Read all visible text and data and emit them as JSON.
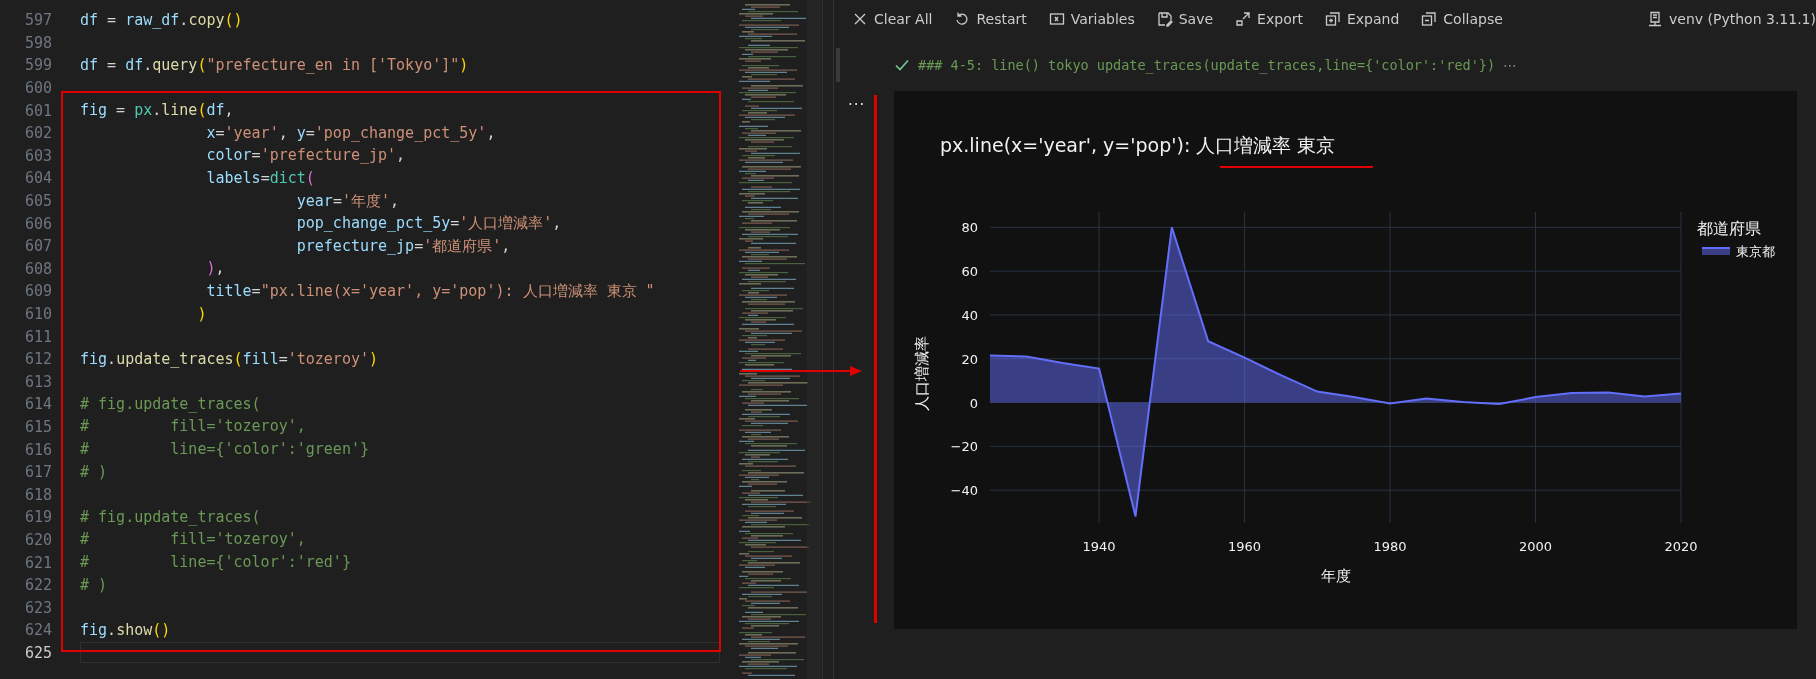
{
  "editor": {
    "lines": [
      {
        "number": "597",
        "current": false,
        "tokens": [
          {
            "text": "df",
            "kind": "var"
          },
          {
            "text": " = ",
            "kind": "op"
          },
          {
            "text": "raw_df",
            "kind": "var"
          },
          {
            "text": ".",
            "kind": "op"
          },
          {
            "text": "copy",
            "kind": "func"
          },
          {
            "text": "()",
            "kind": "bracket"
          }
        ]
      },
      {
        "number": "598",
        "current": false
      },
      {
        "number": "599",
        "current": false,
        "tokens": [
          {
            "text": "df",
            "kind": "var"
          },
          {
            "text": " = ",
            "kind": "op"
          },
          {
            "text": "df",
            "kind": "var"
          },
          {
            "text": ".",
            "kind": "op"
          },
          {
            "text": "query",
            "kind": "func"
          },
          {
            "text": "(",
            "kind": "bracket"
          },
          {
            "text": "\"prefecture_en in ['Tokyo']\"",
            "kind": "str"
          },
          {
            "text": ")",
            "kind": "bracket"
          }
        ]
      },
      {
        "number": "600",
        "current": false
      },
      {
        "number": "601",
        "current": false,
        "tokens": [
          {
            "text": "fig",
            "kind": "var"
          },
          {
            "text": " = ",
            "kind": "op"
          },
          {
            "text": "px",
            "kind": "cls"
          },
          {
            "text": ".",
            "kind": "op"
          },
          {
            "text": "line",
            "kind": "func"
          },
          {
            "text": "(",
            "kind": "bracket"
          },
          {
            "text": "df",
            "kind": "var"
          },
          {
            "text": ",",
            "kind": "op"
          }
        ]
      },
      {
        "number": "602",
        "current": false,
        "tokens": [
          {
            "text": "              x",
            "kind": "var"
          },
          {
            "text": "=",
            "kind": "op"
          },
          {
            "text": "'year'",
            "kind": "str"
          },
          {
            "text": ", ",
            "kind": "op"
          },
          {
            "text": "y",
            "kind": "var"
          },
          {
            "text": "=",
            "kind": "op"
          },
          {
            "text": "'pop_change_pct_5y'",
            "kind": "str"
          },
          {
            "text": ",",
            "kind": "op"
          }
        ]
      },
      {
        "number": "603",
        "current": false,
        "tokens": [
          {
            "text": "              color",
            "kind": "var"
          },
          {
            "text": "=",
            "kind": "op"
          },
          {
            "text": "'prefecture_jp'",
            "kind": "str"
          },
          {
            "text": ",",
            "kind": "op"
          }
        ]
      },
      {
        "number": "604",
        "current": false,
        "tokens": [
          {
            "text": "              labels",
            "kind": "var"
          },
          {
            "text": "=",
            "kind": "op"
          },
          {
            "text": "dict",
            "kind": "cls"
          },
          {
            "text": "(",
            "kind": "bracket2"
          }
        ]
      },
      {
        "number": "605",
        "current": false,
        "tokens": [
          {
            "text": "                        year",
            "kind": "var"
          },
          {
            "text": "=",
            "kind": "op"
          },
          {
            "text": "'年度'",
            "kind": "str"
          },
          {
            "text": ",",
            "kind": "op"
          }
        ]
      },
      {
        "number": "606",
        "current": false,
        "tokens": [
          {
            "text": "                        pop_change_pct_5y",
            "kind": "var"
          },
          {
            "text": "=",
            "kind": "op"
          },
          {
            "text": "'人口増減率'",
            "kind": "str"
          },
          {
            "text": ",",
            "kind": "op"
          }
        ]
      },
      {
        "number": "607",
        "current": false,
        "tokens": [
          {
            "text": "                        prefecture_jp",
            "kind": "var"
          },
          {
            "text": "=",
            "kind": "op"
          },
          {
            "text": "'都道府県'",
            "kind": "str"
          },
          {
            "text": ",",
            "kind": "op"
          }
        ]
      },
      {
        "number": "608",
        "current": false,
        "tokens": [
          {
            "text": "              )",
            "kind": "bracket2"
          },
          {
            "text": ",",
            "kind": "op"
          }
        ]
      },
      {
        "number": "609",
        "current": false,
        "tokens": [
          {
            "text": "              title",
            "kind": "var"
          },
          {
            "text": "=",
            "kind": "op"
          },
          {
            "text": "\"px.line(x='year', y='pop'): 人口増減率 東京 \"",
            "kind": "str"
          }
        ]
      },
      {
        "number": "610",
        "current": false,
        "tokens": [
          {
            "text": "             )",
            "kind": "bracket"
          }
        ]
      },
      {
        "number": "611",
        "current": false
      },
      {
        "number": "612",
        "current": false,
        "tokens": [
          {
            "text": "fig",
            "kind": "var"
          },
          {
            "text": ".",
            "kind": "op"
          },
          {
            "text": "update_traces",
            "kind": "func"
          },
          {
            "text": "(",
            "kind": "bracket"
          },
          {
            "text": "fill",
            "kind": "var"
          },
          {
            "text": "=",
            "kind": "op"
          },
          {
            "text": "'tozeroy'",
            "kind": "str"
          },
          {
            "text": ")",
            "kind": "bracket"
          }
        ]
      },
      {
        "number": "613",
        "current": false
      },
      {
        "number": "614",
        "current": false,
        "tokens": [
          {
            "text": "# fig.update_traces(",
            "kind": "comment"
          }
        ]
      },
      {
        "number": "615",
        "current": false,
        "tokens": [
          {
            "text": "#         fill='tozeroy',",
            "kind": "comment"
          }
        ]
      },
      {
        "number": "616",
        "current": false,
        "tokens": [
          {
            "text": "#         line={'color':'green'}",
            "kind": "comment"
          }
        ]
      },
      {
        "number": "617",
        "current": false,
        "tokens": [
          {
            "text": "# )",
            "kind": "comment"
          }
        ]
      },
      {
        "number": "618",
        "current": false
      },
      {
        "number": "619",
        "current": false,
        "tokens": [
          {
            "text": "# fig.update_traces(",
            "kind": "comment"
          }
        ]
      },
      {
        "number": "620",
        "current": false,
        "tokens": [
          {
            "text": "#         fill='tozeroy',",
            "kind": "comment"
          }
        ]
      },
      {
        "number": "621",
        "current": false,
        "tokens": [
          {
            "text": "#         line={'color':'red'}",
            "kind": "comment"
          }
        ]
      },
      {
        "number": "622",
        "current": false,
        "tokens": [
          {
            "text": "# )",
            "kind": "comment"
          }
        ]
      },
      {
        "number": "623",
        "current": false
      },
      {
        "number": "624",
        "current": false,
        "tokens": [
          {
            "text": "fig",
            "kind": "var"
          },
          {
            "text": ".",
            "kind": "op"
          },
          {
            "text": "show",
            "kind": "func"
          },
          {
            "text": "()",
            "kind": "bracket"
          }
        ]
      },
      {
        "number": "625",
        "current": true
      }
    ]
  },
  "notebook": {
    "toolbar": [
      {
        "label": "Clear All",
        "kind": "clear"
      },
      {
        "label": "Restart",
        "kind": "restart"
      },
      {
        "label": "Variables",
        "kind": "variables"
      },
      {
        "label": "Save",
        "kind": "save"
      },
      {
        "label": "Export",
        "kind": "export"
      },
      {
        "label": "Expand",
        "kind": "expand"
      },
      {
        "label": "Collapse",
        "kind": "collapse"
      }
    ],
    "kernel": "venv (Python 3.11.1)",
    "cell": {
      "succeeded": true,
      "title": "### 4-5: line() tokyo update_traces(update_traces,line={'color':'red'})",
      "more": "⋯"
    },
    "output": {
      "more": "...",
      "legend_title": "都道府県",
      "chart_data": {
        "type": "area",
        "grid": true,
        "title": "px.line(x='year', y='pop'): 人口増減率 東京",
        "xlabel": "年度",
        "ylabel": "人口増減率",
        "x": [
          1925,
          1930,
          1935,
          1940,
          1945,
          1950,
          1955,
          1960,
          1965,
          1970,
          1975,
          1980,
          1985,
          1990,
          1995,
          2000,
          2005,
          2010,
          2015,
          2020
        ],
        "series": [
          {
            "name": "東京都",
            "color": "#636efa",
            "values": [
              21.5,
              21,
              18,
              15.5,
              -52,
              80,
              28,
              20.5,
              12.5,
              5,
              2.5,
              -0.5,
              1.8,
              0.3,
              -0.7,
              2.5,
              4.3,
              4.6,
              2.7,
              4.1
            ]
          }
        ],
        "xlim": [
          1925,
          2020
        ],
        "ylim": [
          -55,
          87
        ],
        "xticks": [
          1940,
          1960,
          1980,
          2000,
          2020
        ],
        "yticks": [
          {
            "value": -40,
            "label": "−40"
          },
          {
            "value": -20,
            "label": "−20"
          },
          {
            "value": 0,
            "label": "0"
          },
          {
            "value": 20,
            "label": "20"
          },
          {
            "value": 40,
            "label": "40"
          },
          {
            "value": 60,
            "label": "60"
          },
          {
            "value": 80,
            "label": "80"
          }
        ]
      }
    }
  }
}
